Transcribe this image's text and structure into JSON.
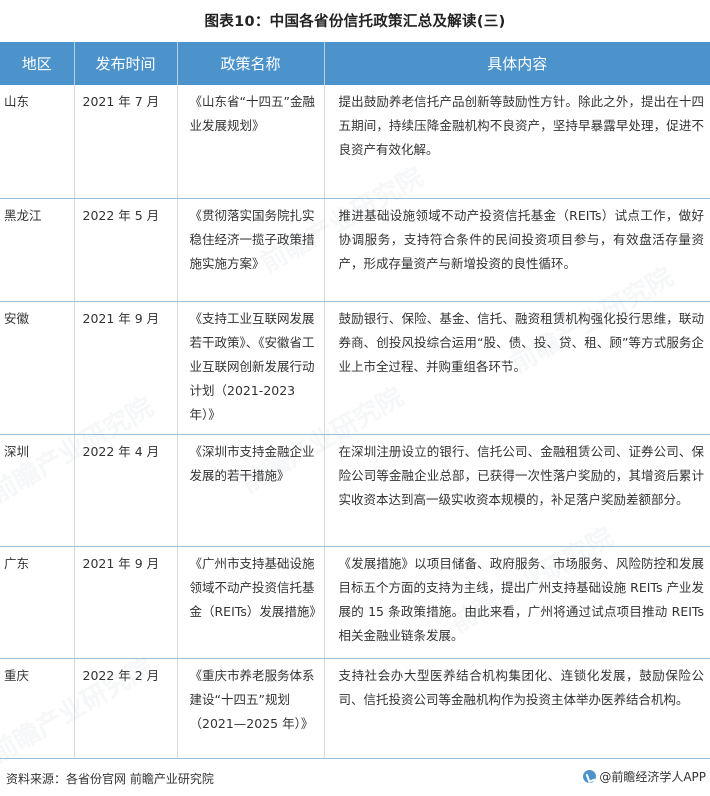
{
  "title": "图表10：中国各省份信托政策汇总及解读(三)",
  "table": {
    "headers": [
      "地区",
      "发布时间",
      "政策名称",
      "具体内容"
    ],
    "rows": [
      {
        "region": "山东",
        "date": "2021 年 7 月",
        "policy": "《山东省“十四五”金融业发展规划》",
        "content": "提出鼓励养老信托产品创新等鼓励性方针。除此之外，提出在十四五期间，持续压降金融机构不良资产，坚持早暴露早处理，促进不良资产有效化解。"
      },
      {
        "region": "黑龙江",
        "date": "2022 年 5 月",
        "policy": "《贯彻落实国务院扎实稳住经济一揽子政策措施实施方案》",
        "content": "推进基础设施领域不动产投资信托基金（REITs）试点工作，做好协调服务，支持符合条件的民间投资项目参与，有效盘活存量资产，形成存量资产与新增投资的良性循环。"
      },
      {
        "region": "安徽",
        "date": "2021 年 9 月",
        "policy": "《支持工业互联网发展若干政策》、《安徽省工业互联网创新发展行动计划（2021-2023年）》",
        "content": "鼓励银行、保险、基金、信托、融资租赁机构强化投行思维，联动券商、创投风投综合运用“股、债、投、贷、租、顾”等方式服务企业上市全过程、并购重组各环节。"
      },
      {
        "region": "深圳",
        "date": "2022 年 4 月",
        "policy": "《深圳市支持金融企业发展的若干措施》",
        "content": "在深圳注册设立的银行、信托公司、金融租赁公司、证券公司、保险公司等金融企业总部，已获得一次性落户奖励的，其增资后累计实收资本达到高一级实收资本规模的，补足落户奖励差额部分。"
      },
      {
        "region": "广东",
        "date": "2021 年 9 月",
        "policy": "《广州市支持基础设施领域不动产投资信托基金（REITs）发展措施》",
        "content": "《发展措施》以项目储备、政府服务、市场服务、风险防控和发展目标五个方面的支持为主线，提出广州支持基础设施 REITs 产业发展的 15 条政策措施。由此来看，广州将通过试点项目推动 REITs 相关金融业链条发展。"
      },
      {
        "region": "重庆",
        "date": "2022 年 2 月",
        "policy": "《重庆市养老服务体系建设“十四五”规划（2021—2025 年）》",
        "content": "支持社会办大型医养结合机构集团化、连锁化发展，鼓励保险公司、信托投资公司等金融机构作为投资主体举办医养结合机构。"
      }
    ]
  },
  "footer": {
    "source": "资料来源：各省份官网 前瞻产业研究院",
    "brand": "@前瞻经济学人APP"
  },
  "watermark": "前瞻产业研究院",
  "accent_color": "#4c93cb"
}
